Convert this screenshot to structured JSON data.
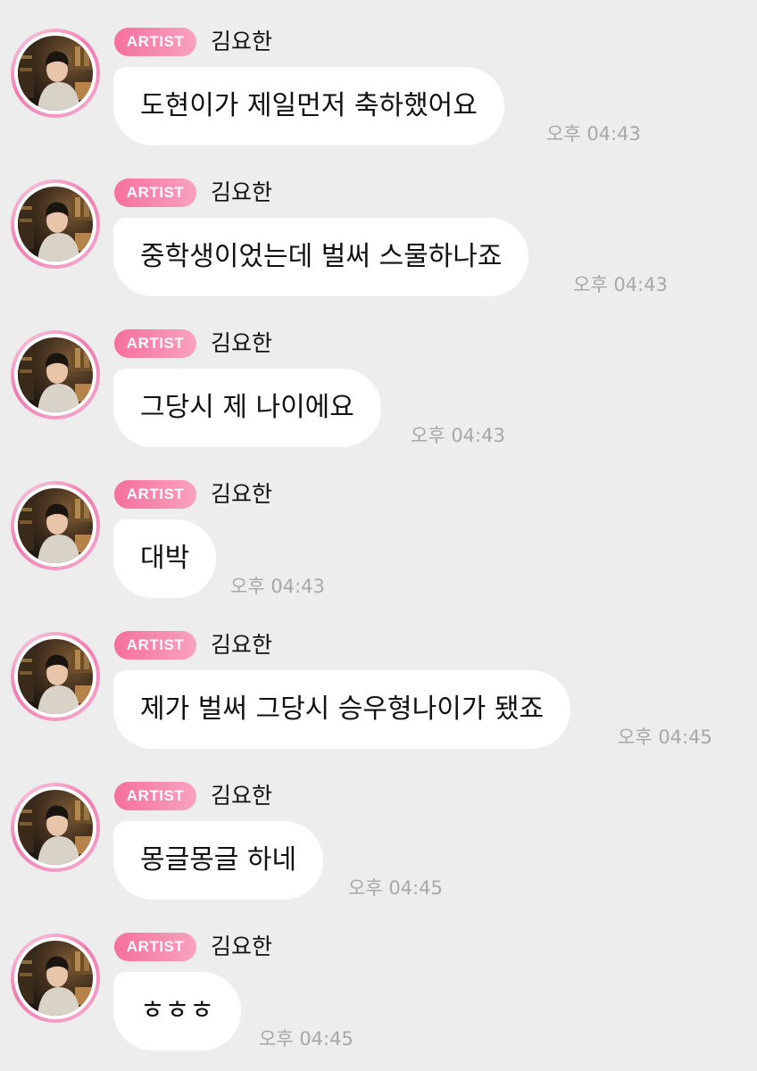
{
  "messages": [
    {
      "badge": "ARTIST",
      "name": "김요한",
      "text": "도현이가 제일먼저 축하했어요",
      "time": "오후 04:43"
    },
    {
      "badge": "ARTIST",
      "name": "김요한",
      "text": "중학생이었는데 벌써 스물하나죠",
      "time": "오후 04:43"
    },
    {
      "badge": "ARTIST",
      "name": "김요한",
      "text": "그당시 제 나이에요",
      "time": "오후 04:43"
    },
    {
      "badge": "ARTIST",
      "name": "김요한",
      "text": "대박",
      "time": "오후 04:43"
    },
    {
      "badge": "ARTIST",
      "name": "김요한",
      "text": "제가 벌써 그당시 승우형나이가 됐죠",
      "time": "오후 04:45"
    },
    {
      "badge": "ARTIST",
      "name": "김요한",
      "text": "몽글몽글 하네",
      "time": "오후 04:45"
    },
    {
      "badge": "ARTIST",
      "name": "김요한",
      "text": "ㅎㅎㅎ",
      "time": "오후 04:45"
    }
  ],
  "colors": {
    "background": "#ededed",
    "badge_start": "#f66f9d",
    "badge_end": "#f8a3bf",
    "avatar_ring": "#f17bb0",
    "bubble": "#ffffff",
    "timestamp": "#a8a8a8"
  },
  "icons": {
    "avatar": "profile-photo"
  }
}
